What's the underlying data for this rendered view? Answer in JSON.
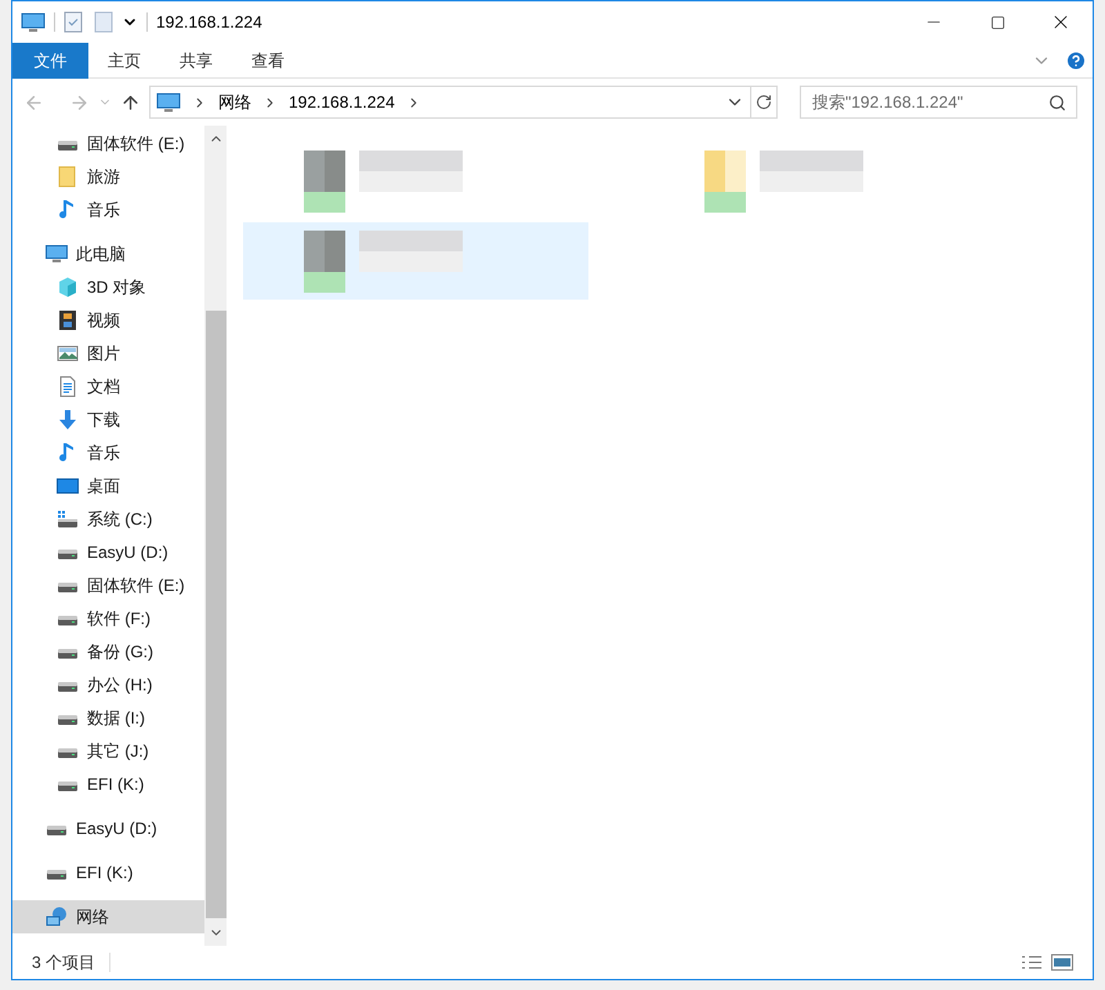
{
  "window": {
    "title": "192.168.1.224"
  },
  "ribbon_tabs": [
    {
      "label": "文件",
      "selected": true
    },
    {
      "label": "主页",
      "selected": false
    },
    {
      "label": "共享",
      "selected": false
    },
    {
      "label": "查看",
      "selected": false
    }
  ],
  "address": {
    "segments": [
      "网络",
      "192.168.1.224"
    ]
  },
  "search": {
    "placeholder": "搜索\"192.168.1.224\""
  },
  "nav_tree": [
    {
      "children": [
        {
          "label": "固体软件 (E:)",
          "kind": "drive",
          "selected": false
        },
        {
          "label": "旅游",
          "kind": "folder",
          "selected": false
        },
        {
          "label": "音乐",
          "kind": "music",
          "selected": false
        }
      ]
    },
    {
      "label": "此电脑",
      "kind": "pc",
      "selected": false,
      "children": [
        {
          "label": "3D 对象",
          "kind": "cube",
          "selected": false
        },
        {
          "label": "视频",
          "kind": "video",
          "selected": false
        },
        {
          "label": "图片",
          "selected": false
        },
        {
          "label": "文档",
          "kind": "document",
          "selected": false
        },
        {
          "label": "下载",
          "kind": "download",
          "selected": false
        },
        {
          "label": "音乐",
          "kind": "music",
          "selected": false
        },
        {
          "label": "桌面",
          "kind": "desktop",
          "selected": false
        },
        {
          "label": "系统 (C:)",
          "kind": "system-drive",
          "selected": false
        },
        {
          "label": "EasyU (D:)",
          "kind": "drive",
          "selected": false
        },
        {
          "label": "固体软件 (E:)",
          "kind": "drive",
          "selected": false
        },
        {
          "label": "软件 (F:)",
          "kind": "drive",
          "selected": false
        },
        {
          "label": "备份 (G:)",
          "kind": "drive",
          "selected": false
        },
        {
          "label": "办公 (H:)",
          "kind": "drive",
          "selected": false
        },
        {
          "label": "数据 (I:)",
          "kind": "drive",
          "selected": false
        },
        {
          "label": "其它 (J:)",
          "kind": "drive",
          "selected": false
        },
        {
          "label": "EFI (K:)",
          "kind": "drive",
          "selected": false
        }
      ]
    },
    {
      "label": "EasyU (D:)",
      "kind": "drive",
      "selected": false
    },
    {
      "label": "EFI (K:)",
      "kind": "drive",
      "selected": false
    },
    {
      "label": "网络",
      "kind": "network",
      "selected": true
    }
  ],
  "content_items": [
    {
      "kind": "share",
      "selected": false
    },
    {
      "kind": "folder",
      "selected": false
    },
    {
      "kind": "share",
      "selected": true
    }
  ],
  "status_bar": {
    "count": "3 个项目"
  }
}
